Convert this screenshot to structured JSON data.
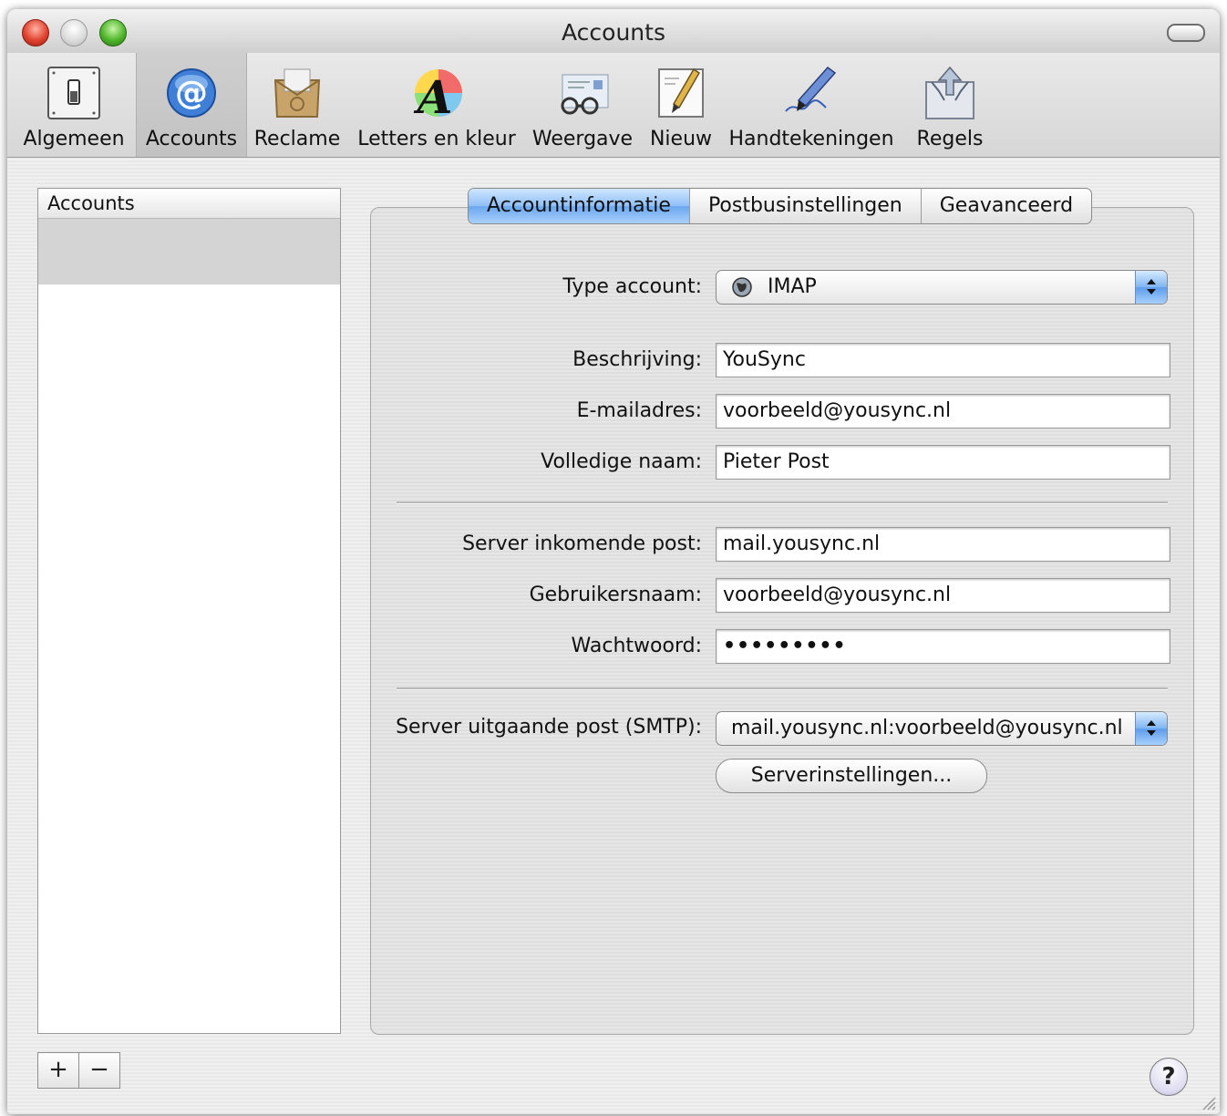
{
  "window": {
    "title": "Accounts"
  },
  "toolbar": {
    "items": [
      {
        "label": "Algemeen",
        "icon": "switch-icon"
      },
      {
        "label": "Accounts",
        "icon": "at-sign-icon",
        "selected": true
      },
      {
        "label": "Reclame",
        "icon": "junk-mail-icon"
      },
      {
        "label": "Letters en kleur",
        "icon": "font-color-icon"
      },
      {
        "label": "Weergave",
        "icon": "glasses-icon"
      },
      {
        "label": "Nieuw",
        "icon": "compose-icon"
      },
      {
        "label": "Handtekeningen",
        "icon": "signature-pen-icon"
      },
      {
        "label": "Regels",
        "icon": "rules-icon"
      }
    ]
  },
  "sidebar": {
    "header": "Accounts",
    "add_label": "+",
    "remove_label": "−"
  },
  "tabs": [
    {
      "label": "Accountinformatie",
      "active": true
    },
    {
      "label": "Postbusinstellingen",
      "active": false
    },
    {
      "label": "Geavanceerd",
      "active": false
    }
  ],
  "form": {
    "type_label": "Type account:",
    "type_value": "IMAP",
    "description_label": "Beschrijving:",
    "description_value": "YouSync",
    "email_label": "E-mailadres:",
    "email_value": "voorbeeld@yousync.nl",
    "fullname_label": "Volledige naam:",
    "fullname_value": "Pieter Post",
    "incoming_label": "Server inkomende post:",
    "incoming_value": "mail.yousync.nl",
    "username_label": "Gebruikersnaam:",
    "username_value": "voorbeeld@yousync.nl",
    "password_label": "Wachtwoord:",
    "password_value": "•••••••••",
    "smtp_label": "Server uitgaande post (SMTP):",
    "smtp_value": "mail.yousync.nl:voorbeeld@yousync.nl",
    "server_settings_label": "Serverinstellingen..."
  },
  "help": {
    "label": "?"
  },
  "colors": {
    "selection_blue": "#6aa7f0",
    "close_red": "#e0432f",
    "zoom_green": "#4fb52b"
  }
}
